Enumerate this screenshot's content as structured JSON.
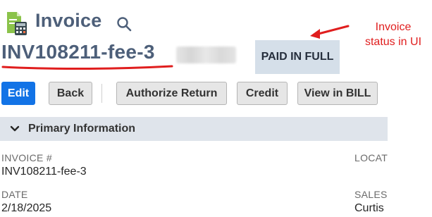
{
  "header": {
    "title": "Invoice",
    "record_icon": "invoice-calculator-icon",
    "search_icon": "search-icon"
  },
  "record": {
    "number": "INV108211-fee-3",
    "status": "PAID IN FULL"
  },
  "annotation": {
    "text_line1": "Invoice",
    "text_line2": "status in UI",
    "color": "#e01e1e"
  },
  "toolbar": {
    "edit_label": "Edit",
    "back_label": "Back",
    "authorize_return_label": "Authorize Return",
    "credit_label": "Credit",
    "view_in_bill_label": "View in BILL"
  },
  "section": {
    "title": "Primary Information",
    "chevron_icon": "chevron-down-icon"
  },
  "fields": {
    "invoice_label": "INVOICE #",
    "invoice_value": "INV108211-fee-3",
    "date_label": "DATE",
    "date_value": "2/18/2025",
    "location_label": "LOCAT",
    "sales_label": "SALES",
    "sales_value": "Curtis"
  },
  "colors": {
    "title": "#4d5f79",
    "primary_button": "#1273e6",
    "status_badge_bg": "#d5dfe9",
    "section_header_bg": "#dfe4eb"
  }
}
